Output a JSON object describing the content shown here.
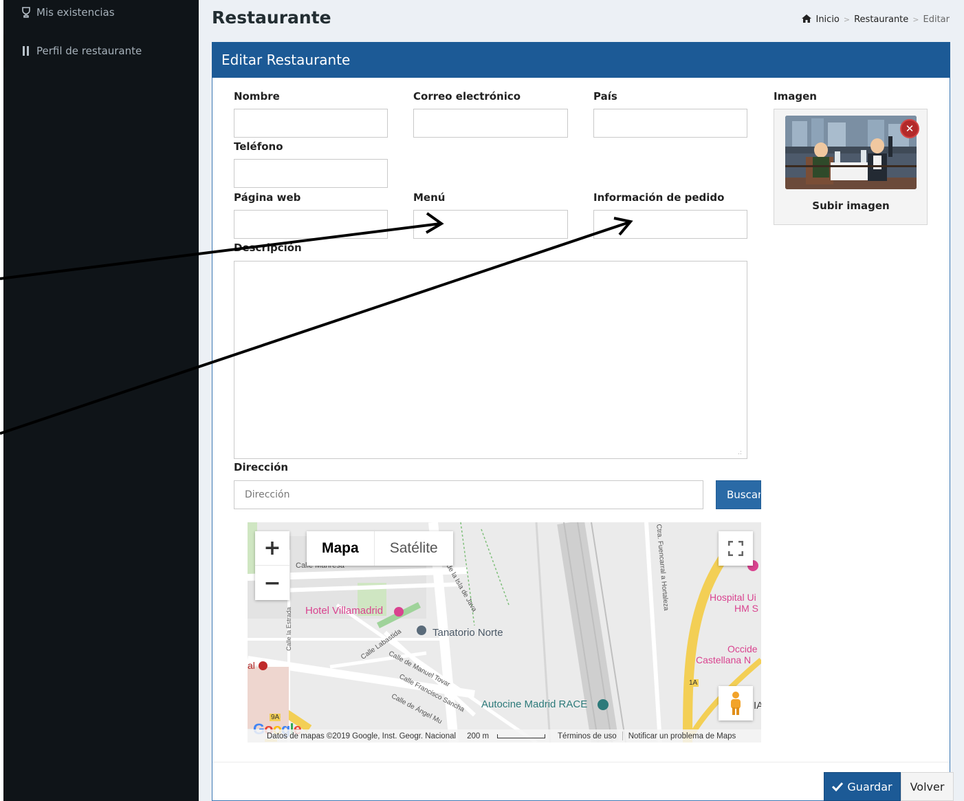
{
  "sidebar": {
    "items": [
      {
        "label": "Mis existencias",
        "icon": "glass-icon"
      },
      {
        "label": "Perfil de restaurante",
        "icon": "utensils-icon"
      }
    ]
  },
  "header": {
    "title": "Restaurante",
    "breadcrumb": {
      "home": "Inicio",
      "section": "Restaurante",
      "current": "Editar"
    }
  },
  "form": {
    "box_title": "Editar Restaurante",
    "labels": {
      "nombre": "Nombre",
      "correo": "Correo electrónico",
      "pais": "País",
      "imagen": "Imagen",
      "telefono": "Teléfono",
      "pagina_web": "Página web",
      "menu": "Menú",
      "info_pedido": "Información de pedido",
      "descripcion": "Descripción",
      "direccion": "Dirección"
    },
    "values": {
      "nombre": "",
      "correo": "",
      "pais": "",
      "telefono": "",
      "pagina_web": "",
      "menu": "",
      "info_pedido": "",
      "descripcion": "",
      "direccion": ""
    },
    "direccion_placeholder": "Dirección",
    "buscar_label": "Buscar",
    "upload_label": "Subir imagen",
    "remove_glyph": "✕"
  },
  "map": {
    "type_buttons": [
      "Mapa",
      "Satélite"
    ],
    "zoom_in": "+",
    "zoom_out": "−",
    "labels": {
      "hotel": "Hotel Villamadrid",
      "tanatorio": "Tanatorio Norte",
      "autocine": "Autocine Madrid RACE",
      "hospital_1": "Hospital Ui",
      "hospital_2": "HM S",
      "occide_1": "Occide",
      "occide_2": "Castellana N",
      "calle_manresa": "Calle Manresa",
      "calle_labastida": "Calle Labastida",
      "calle_manuel_tovar": "Calle de Manuel Tovar",
      "calle_francisco_sancha": "Calle Francisco Sancha",
      "calle_angel": "Calle de Ángel Mu",
      "calle_isla_java": "de la Isla de Java",
      "calle_la_estrada": "Calle la Estrada",
      "ctra": "Ctra. Fuencarral a Hortaleza",
      "al": "al",
      "ia": "IA",
      "road_9a": "9A",
      "road_1a": "1A"
    },
    "google": "Google",
    "attribution": "Datos de mapas ©2019 Google, Inst. Geogr. Nacional",
    "scale": "200 m",
    "terms": "Términos de uso",
    "report": "Notificar un problema de Maps"
  },
  "footer": {
    "guardar": "Guardar",
    "volver": "Volver"
  },
  "colors": {
    "sidebar_bg": "#0f1418",
    "header_blue": "#1c5a96",
    "content_bg": "#ecf0f5"
  }
}
